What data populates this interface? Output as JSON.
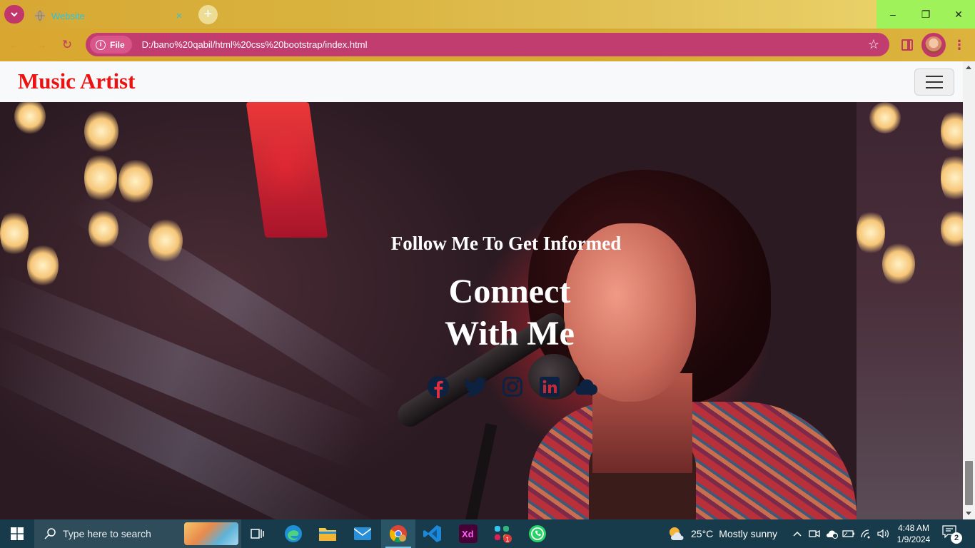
{
  "browser": {
    "tab": {
      "title": "Website",
      "close": "×"
    },
    "new_tab": "+",
    "window_controls": {
      "minimize": "–",
      "restore": "❐",
      "close": "✕"
    },
    "nav": {
      "back": "←",
      "forward": "→",
      "reload": "↻"
    },
    "omnibox": {
      "chip_label": "File",
      "url": "D:/bano%20qabil/html%20css%20bootstrap/index.html",
      "star": "☆"
    },
    "menu": "⋮"
  },
  "page": {
    "brand": "Music Artist",
    "hero": {
      "subtitle": "Follow Me To Get Informed",
      "title_line1": "Connect",
      "title_line2": "With Me"
    },
    "social_icons": [
      "facebook-icon",
      "twitter-icon",
      "instagram-icon",
      "linkedin-icon",
      "cloud-icon"
    ],
    "colors": {
      "brand": "#ee1111",
      "social": "#0d2140",
      "navbar_bg": "#f8f9fa"
    }
  },
  "taskbar": {
    "search_placeholder": "Type here to search",
    "weather": {
      "temp": "25°C",
      "condition": "Mostly sunny"
    },
    "clock": {
      "time": "4:48 AM",
      "date": "1/9/2024"
    },
    "notification_count": "2",
    "slack_badge": "1"
  }
}
